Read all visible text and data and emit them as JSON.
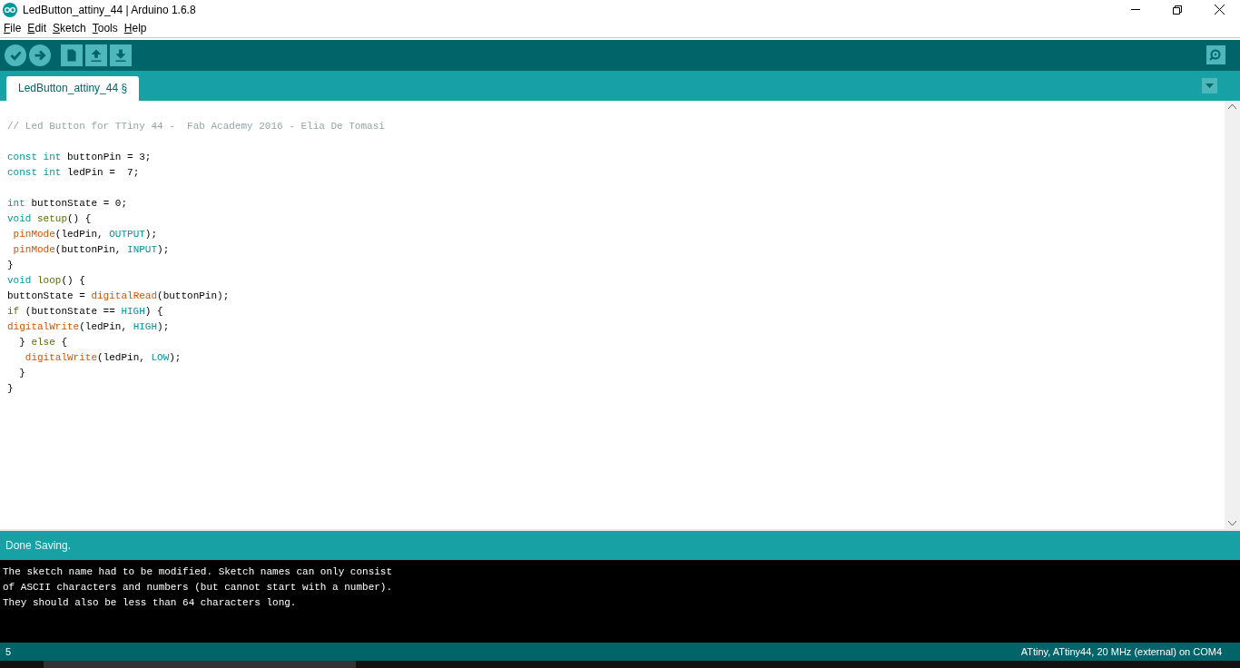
{
  "window": {
    "title": "LedButton_attiny_44 | Arduino 1.6.8"
  },
  "menu": [
    "File",
    "Edit",
    "Sketch",
    "Tools",
    "Help"
  ],
  "toolbar": [
    {
      "kind": "verify"
    },
    {
      "kind": "upload"
    },
    {
      "kind": "new"
    },
    {
      "kind": "open"
    },
    {
      "kind": "save"
    }
  ],
  "tabs": [
    {
      "label": "LedButton_attiny_44 §",
      "selected": true
    }
  ],
  "editor": {
    "blocks": [
      [
        [
          {
            "text": "// Led Button for TTiny 44 -  Fab Academy 2016 - Elia De Tomasi",
            "kind": "comment"
          }
        ]
      ],
      [
        [
          {
            "text": "const int",
            "kind": "keyword"
          },
          {
            "text": " buttonPin = 3;"
          }
        ],
        [
          {
            "text": "const int",
            "kind": "keyword"
          },
          {
            "text": " ledPin =  7;"
          }
        ]
      ],
      [
        [
          {
            "text": "int",
            "kind": "keyword"
          },
          {
            "text": " buttonState = 0;"
          }
        ],
        [
          {
            "text": "void",
            "kind": "keyword"
          },
          {
            "text": " setup",
            "kind": "structure"
          },
          {
            "text": "() {"
          }
        ],
        [
          {
            "text": " pinMode",
            "kind": "function"
          },
          {
            "text": "(ledPin, "
          },
          {
            "text": "OUTPUT",
            "kind": "constant"
          },
          {
            "text": ");"
          }
        ],
        [
          {
            "text": " pinMode",
            "kind": "function"
          },
          {
            "text": "(buttonPin, "
          },
          {
            "text": "INPUT",
            "kind": "constant"
          },
          {
            "text": ");"
          }
        ],
        [
          {
            "text": "}"
          }
        ],
        [
          {
            "text": "void",
            "kind": "keyword"
          },
          {
            "text": " loop",
            "kind": "structure"
          },
          {
            "text": "() {"
          }
        ],
        [
          {
            "text": "buttonState = "
          },
          {
            "text": "digitalRead",
            "kind": "function"
          },
          {
            "text": "(buttonPin);"
          }
        ],
        [
          {
            "text": "if",
            "kind": "structure"
          },
          {
            "text": " (buttonState == "
          },
          {
            "text": "HIGH",
            "kind": "constant"
          },
          {
            "text": ") {"
          }
        ],
        [
          {
            "text": "digitalWrite",
            "kind": "function"
          },
          {
            "text": "(ledPin, "
          },
          {
            "text": "HIGH",
            "kind": "constant"
          },
          {
            "text": ");"
          }
        ],
        [
          {
            "text": "  } "
          },
          {
            "text": "else",
            "kind": "structure"
          },
          {
            "text": " {"
          }
        ],
        [
          {
            "text": "   digitalWrite",
            "kind": "function"
          },
          {
            "text": "(ledPin, "
          },
          {
            "text": "LOW",
            "kind": "constant"
          },
          {
            "text": ");"
          }
        ],
        [
          {
            "text": "  }"
          }
        ],
        [
          {
            "text": "}"
          }
        ]
      ]
    ]
  },
  "status": "Done Saving.",
  "console": [
    "The sketch name had to be modified. Sketch names can only consist",
    "of ASCII characters and numbers (but cannot start with a number).",
    "They should also be less than 64 characters long."
  ],
  "footer": {
    "line": "5",
    "board": "ATtiny, ATtiny44, 20 MHz (external) on COM4"
  }
}
